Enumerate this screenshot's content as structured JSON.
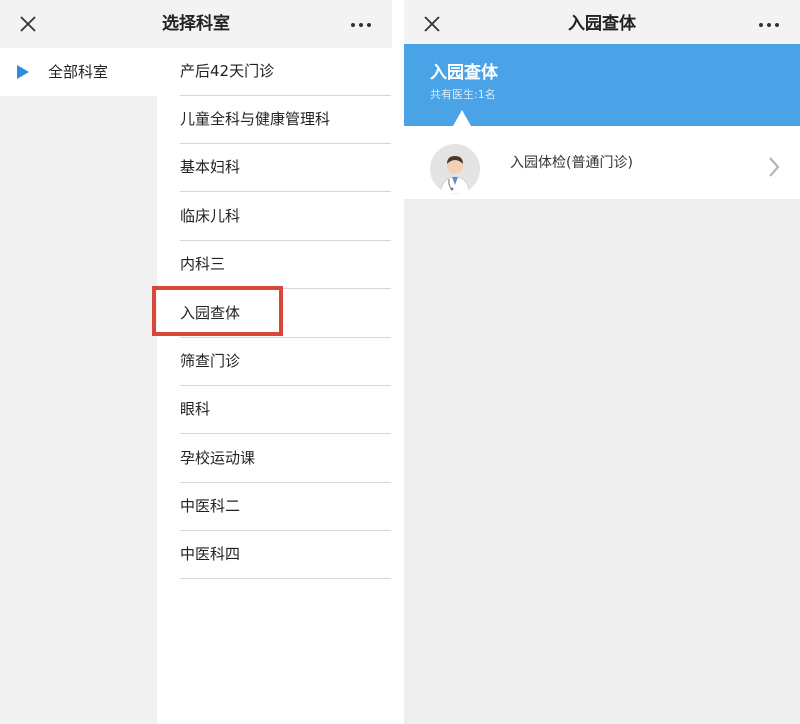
{
  "left_screen": {
    "header": {
      "title": "选择科室",
      "close_icon": "close-icon",
      "more_icon": "more-icon"
    },
    "sidebar": {
      "items": [
        {
          "label": "全部科室",
          "selected": true
        }
      ]
    },
    "departments": [
      {
        "label": "产后42天门诊"
      },
      {
        "label": "儿童全科与健康管理科"
      },
      {
        "label": "基本妇科"
      },
      {
        "label": "临床儿科"
      },
      {
        "label": "内科三"
      },
      {
        "label": "入园查体",
        "highlighted": true
      },
      {
        "label": "筛查门诊"
      },
      {
        "label": "眼科"
      },
      {
        "label": "孕校运动课"
      },
      {
        "label": "中医科二"
      },
      {
        "label": "中医科四"
      }
    ],
    "highlight_color": "#d9473b"
  },
  "right_screen": {
    "header": {
      "title": "入园查体",
      "close_icon": "close-icon",
      "more_icon": "more-icon"
    },
    "banner": {
      "title": "入园查体",
      "subtitle": "共有医生:1名",
      "color": "#4aa3e6"
    },
    "doctors": [
      {
        "name": "入园体检(普通门诊)",
        "avatar_icon": "doctor-avatar-icon"
      }
    ]
  }
}
